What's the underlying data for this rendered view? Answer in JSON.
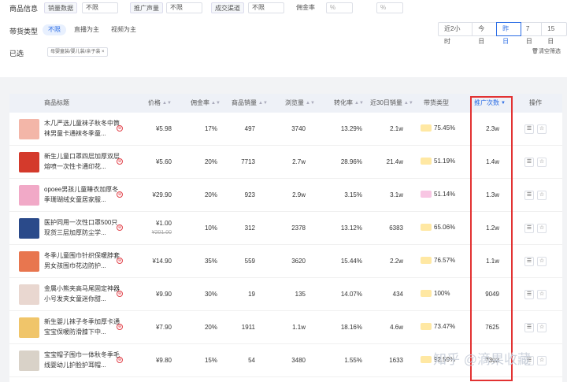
{
  "filters": {
    "row1": {
      "label": "商品信息",
      "pills": [
        "销量数据",
        "不限",
        "推广声量",
        "不限",
        "成交渠道",
        "不限",
        "佣金率",
        "%",
        "%"
      ]
    },
    "row2": {
      "label": "带货类型",
      "options": [
        "不限",
        "直播为主",
        "视频为主"
      ],
      "time_segments": [
        "近2小时",
        "今日",
        "昨日",
        "7日",
        "15日"
      ],
      "active_segment": "昨日"
    },
    "row3": {
      "label": "已选",
      "chip": "母婴童装/婴儿装/亲子装 ×",
      "clear": "清空筛选"
    }
  },
  "table": {
    "headers": {
      "title": "商品标题",
      "price": "价格",
      "commission": "佣金率",
      "sales": "商品销量",
      "views": "浏览量",
      "conversion": "转化率",
      "sales30": "近30日销量",
      "type": "带货类型",
      "promo": "推广次数",
      "ops": "操作"
    },
    "rows": [
      {
        "title": "木几严选儿童袜子秋冬中筒袜男童卡通袜冬季童...",
        "price": "¥5.98",
        "price_old": "",
        "commission": "17%",
        "sales": "497",
        "views": "3740",
        "conversion": "13.29%",
        "sales30": "2.1w",
        "type": "75.45%",
        "promo": "2.3w",
        "thumb": "#f3b6a8"
      },
      {
        "title": "新生儿童口罩四层加厚双层熔喷一次性卡通印花...",
        "price": "¥5.60",
        "price_old": "",
        "commission": "20%",
        "sales": "7713",
        "views": "2.7w",
        "conversion": "28.96%",
        "sales30": "21.4w",
        "type": "51.19%",
        "promo": "1.4w",
        "thumb": "#d43a2c"
      },
      {
        "title": "opoee男孩儿童睡衣加厚冬季珊瑚绒女童居家服...",
        "price": "¥29.90",
        "price_old": "",
        "commission": "20%",
        "sales": "923",
        "views": "2.9w",
        "conversion": "3.15%",
        "sales30": "3.1w",
        "type": "51.14%",
        "promo": "1.3w",
        "thumb": "#f1a9c7"
      },
      {
        "title": "医护同用一次性口罩500只现货三层加厚防尘学...",
        "price": "¥1.00",
        "price_old": "¥201.00",
        "commission": "10%",
        "sales": "312",
        "views": "2378",
        "conversion": "13.12%",
        "sales30": "6383",
        "type": "65.06%",
        "promo": "1.2w",
        "thumb": "#2a4a8a"
      },
      {
        "title": "冬季儿童围巾针织保暖脖套男女孩围巾花边防护...",
        "price": "¥14.90",
        "price_old": "",
        "commission": "35%",
        "sales": "559",
        "views": "3620",
        "conversion": "15.44%",
        "sales30": "2.2w",
        "type": "76.57%",
        "promo": "1.1w",
        "thumb": "#e8764f"
      },
      {
        "title": "金属小熊夹高马尾固定神器小号发夹女童迷你甜...",
        "price": "¥9.90",
        "price_old": "",
        "commission": "30%",
        "sales": "19",
        "views": "135",
        "conversion": "14.07%",
        "sales30": "434",
        "type": "100%",
        "promo": "9049",
        "thumb": "#e9d7d0"
      },
      {
        "title": "新生婴儿袜子冬季加厚卡通宝宝保暖防滑膝下中...",
        "price": "¥7.90",
        "price_old": "",
        "commission": "20%",
        "sales": "1911",
        "views": "1.1w",
        "conversion": "18.16%",
        "sales30": "4.6w",
        "type": "73.47%",
        "promo": "7625",
        "thumb": "#f0c56a"
      },
      {
        "title": "宝宝帽子围巾一体秋冬季毛线婴幼儿护脸护耳帽...",
        "price": "¥9.80",
        "price_old": "",
        "commission": "15%",
        "sales": "54",
        "views": "3480",
        "conversion": "1.55%",
        "sales30": "1633",
        "type": "92.59%",
        "promo": "7302",
        "thumb": "#d9d2c8"
      }
    ]
  },
  "watermark": "知乎 @滴果收藏",
  "colors": {
    "accent": "#2b6de5",
    "highlight": "#e23232"
  }
}
